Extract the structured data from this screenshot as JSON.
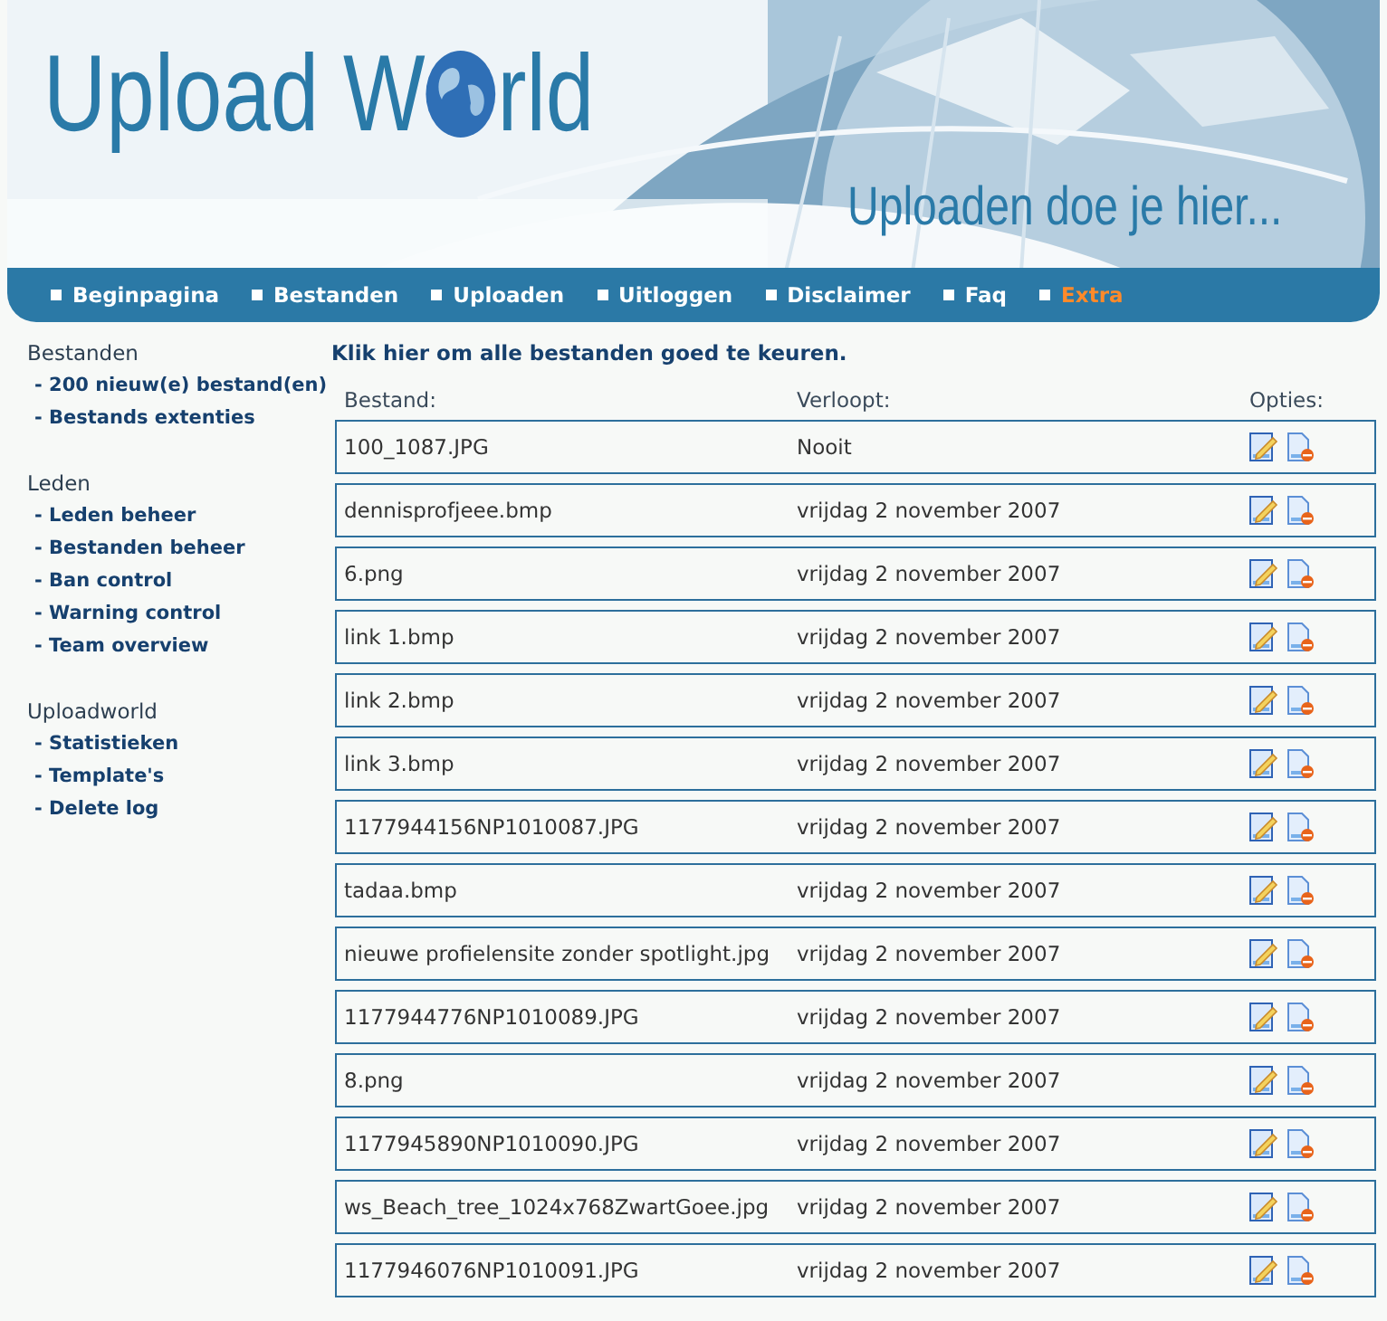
{
  "header": {
    "logo_before": "Upload W",
    "logo_after": "rld",
    "tagline": "Uploaden doe je hier..."
  },
  "nav": [
    {
      "label": "Beginpagina",
      "selected": false
    },
    {
      "label": "Bestanden",
      "selected": false
    },
    {
      "label": "Uploaden",
      "selected": false
    },
    {
      "label": "Uitloggen",
      "selected": false
    },
    {
      "label": "Disclaimer",
      "selected": false
    },
    {
      "label": "Faq",
      "selected": false
    },
    {
      "label": "Extra",
      "selected": true
    }
  ],
  "sidebar": [
    {
      "title": "Bestanden",
      "items": [
        "- 200 nieuw(e) bestand(en)",
        "- Bestands extenties"
      ]
    },
    {
      "title": "Leden",
      "items": [
        "- Leden beheer",
        "- Bestanden beheer",
        "- Ban control",
        "- Warning control",
        "- Team overview"
      ]
    },
    {
      "title": "Uploadworld",
      "items": [
        "- Statistieken",
        "- Template's",
        "- Delete log"
      ]
    }
  ],
  "approve_all_link": "Klik hier om alle bestanden goed te keuren.",
  "table": {
    "columns": [
      "Bestand:",
      "Verloopt:",
      "Opties:"
    ],
    "rows": [
      {
        "file": "100_1087.JPG",
        "expires": "Nooit"
      },
      {
        "file": "dennisprofjeee.bmp",
        "expires": "vrijdag 2 november 2007"
      },
      {
        "file": "6.png",
        "expires": "vrijdag 2 november 2007"
      },
      {
        "file": "link 1.bmp",
        "expires": "vrijdag 2 november 2007"
      },
      {
        "file": "link 2.bmp",
        "expires": "vrijdag 2 november 2007"
      },
      {
        "file": "link 3.bmp",
        "expires": "vrijdag 2 november 2007"
      },
      {
        "file": "1177944156NP1010087.JPG",
        "expires": "vrijdag 2 november 2007"
      },
      {
        "file": "tadaa.bmp",
        "expires": "vrijdag 2 november 2007"
      },
      {
        "file": "nieuwe profielensite zonder spotlight.jpg",
        "expires": "vrijdag 2 november 2007"
      },
      {
        "file": "1177944776NP1010089.JPG",
        "expires": "vrijdag 2 november 2007"
      },
      {
        "file": "8.png",
        "expires": "vrijdag 2 november 2007"
      },
      {
        "file": "1177945890NP1010090.JPG",
        "expires": "vrijdag 2 november 2007"
      },
      {
        "file": "ws_Beach_tree_1024x768ZwartGoee.jpg",
        "expires": "vrijdag 2 november 2007"
      },
      {
        "file": "1177946076NP1010091.JPG",
        "expires": "vrijdag 2 november 2007"
      }
    ]
  }
}
